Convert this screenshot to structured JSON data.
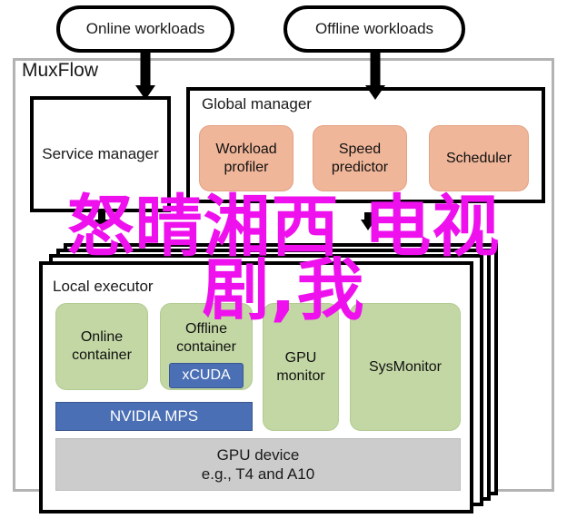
{
  "diagram": {
    "workloads": [
      {
        "label": "Online workloads"
      },
      {
        "label": "Offline workloads"
      }
    ],
    "muxflow": {
      "title": "MuxFlow",
      "service_manager": "Service manager",
      "global_manager": {
        "title": "Global manager",
        "modules": [
          {
            "label": "Workload\nprofiler"
          },
          {
            "label": "Speed\npredictor"
          },
          {
            "label": "Scheduler"
          }
        ]
      },
      "local_executor": {
        "title": "Local executor",
        "containers": [
          {
            "label": "Online\ncontainer"
          },
          {
            "label": "Offline\ncontainer"
          }
        ],
        "xcuda_badge": "xCUDA",
        "mps_bar": "NVIDIA MPS",
        "monitors": [
          {
            "label": "GPU\nmonitor"
          },
          {
            "label": "SysMonitor"
          }
        ],
        "gpu_device": "GPU device\ne.g., T4 and A10"
      }
    }
  },
  "overlay": {
    "text": "怒晴湘西 电视\n剧,我",
    "color": "#ee11ee"
  },
  "colors": {
    "orange_chip": "#f0b699",
    "green_chip": "#c3d7a4",
    "blue_bar": "#4a6fb5",
    "grey_bar": "#cccccc",
    "frame_grey": "#b3b3b3",
    "stroke_black": "#000000"
  }
}
